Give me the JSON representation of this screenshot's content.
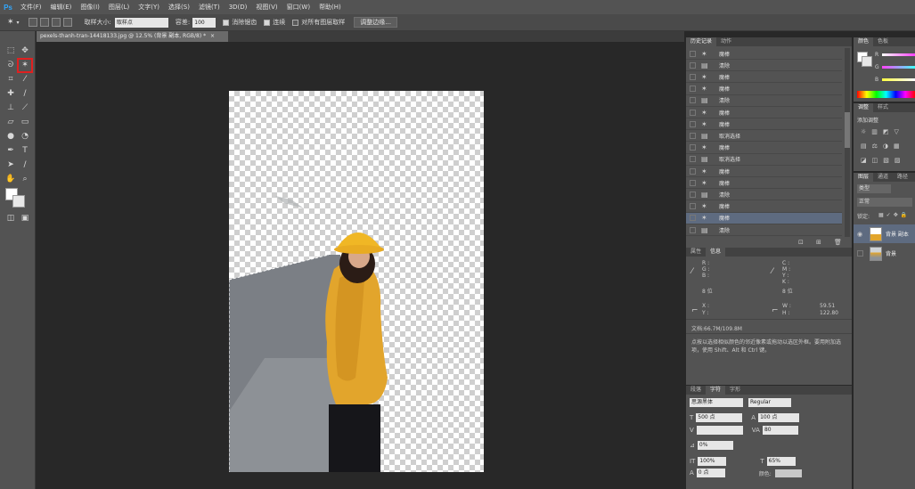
{
  "app": {
    "logo": "Ps"
  },
  "menu": [
    "文件(F)",
    "编辑(E)",
    "图像(I)",
    "图层(L)",
    "文字(Y)",
    "选择(S)",
    "滤镜(T)",
    "3D(D)",
    "视图(V)",
    "窗口(W)",
    "帮助(H)"
  ],
  "options": {
    "sample_size_label": "取样大小:",
    "sample_size_value": "取样点",
    "tolerance_label": "容差:",
    "tolerance_value": "100",
    "anti_alias_label": "消除锯齿",
    "contiguous_label": "连续",
    "sample_all_label": "对所有图层取样",
    "refine_edge_label": "调整边缘..."
  },
  "document": {
    "tab_title": "pexels-thanh-tran-14418133.jpg @ 12.5% (背景 副本, RGB/8) *"
  },
  "history": {
    "tabs": [
      "历史记录",
      "动作"
    ],
    "rows": [
      {
        "icon": "magic-wand-icon",
        "label": "魔棒"
      },
      {
        "icon": "doc-icon",
        "label": "清除"
      },
      {
        "icon": "magic-wand-icon",
        "label": "魔棒"
      },
      {
        "icon": "magic-wand-icon",
        "label": "魔棒"
      },
      {
        "icon": "doc-icon",
        "label": "清除"
      },
      {
        "icon": "magic-wand-icon",
        "label": "魔棒"
      },
      {
        "icon": "magic-wand-icon",
        "label": "魔棒"
      },
      {
        "icon": "doc-icon",
        "label": "取消选择"
      },
      {
        "icon": "magic-wand-icon",
        "label": "魔棒"
      },
      {
        "icon": "doc-icon",
        "label": "取消选择"
      },
      {
        "icon": "magic-wand-icon",
        "label": "魔棒"
      },
      {
        "icon": "magic-wand-icon",
        "label": "魔棒"
      },
      {
        "icon": "doc-icon",
        "label": "清除"
      },
      {
        "icon": "magic-wand-icon",
        "label": "魔棒"
      },
      {
        "icon": "magic-wand-icon",
        "label": "魔棒"
      },
      {
        "icon": "doc-icon",
        "label": "清除"
      }
    ],
    "selected_index": 14
  },
  "info": {
    "tabs": [
      "属性",
      "信息"
    ],
    "r": "R :",
    "g": "G :",
    "b": "B :",
    "bit1": "8 位",
    "c": "C :",
    "m": "M :",
    "y": "Y :",
    "k": "K :",
    "bit2": "8 位",
    "x": "X :",
    "yy": "Y :",
    "w_label": "W :",
    "w_value": "59.51",
    "h_label": "H :",
    "h_value": "122.80",
    "doc_size": "文档:66.7M/109.8M",
    "hint": "点按以选择相似颜色的邻近像素或拖动以选区外框。要用附加选项，使用 Shift、Alt 和 Ctrl 键。"
  },
  "character": {
    "tabs": [
      "段落",
      "字符",
      "字形"
    ],
    "font_family": "思源黑体",
    "font_style": "Regular",
    "size": "500 点",
    "leading": "100 点",
    "tracking": "80",
    "scale_pct": "0%",
    "vscale": "100%",
    "hscale": "65%",
    "baseline": "0 点",
    "color_label": "颜色:"
  },
  "color_panel": {
    "tabs": [
      "颜色",
      "色板"
    ],
    "r": "R",
    "g": "G",
    "b": "B"
  },
  "adjust_panel": {
    "tabs": [
      "调整",
      "样式"
    ],
    "title": "添加调整"
  },
  "layers": {
    "tabs": [
      "图层",
      "通道",
      "路径"
    ],
    "kind": "类型",
    "blend": "正常",
    "lock_label": "锁定:",
    "items": [
      {
        "name": "背景 副本",
        "selected": true
      },
      {
        "name": "背景",
        "selected": false
      }
    ]
  },
  "colors": {
    "accent_selection": "#5e6b80",
    "highlight_red": "#e02020",
    "coat_yellow": "#e2a52c"
  }
}
